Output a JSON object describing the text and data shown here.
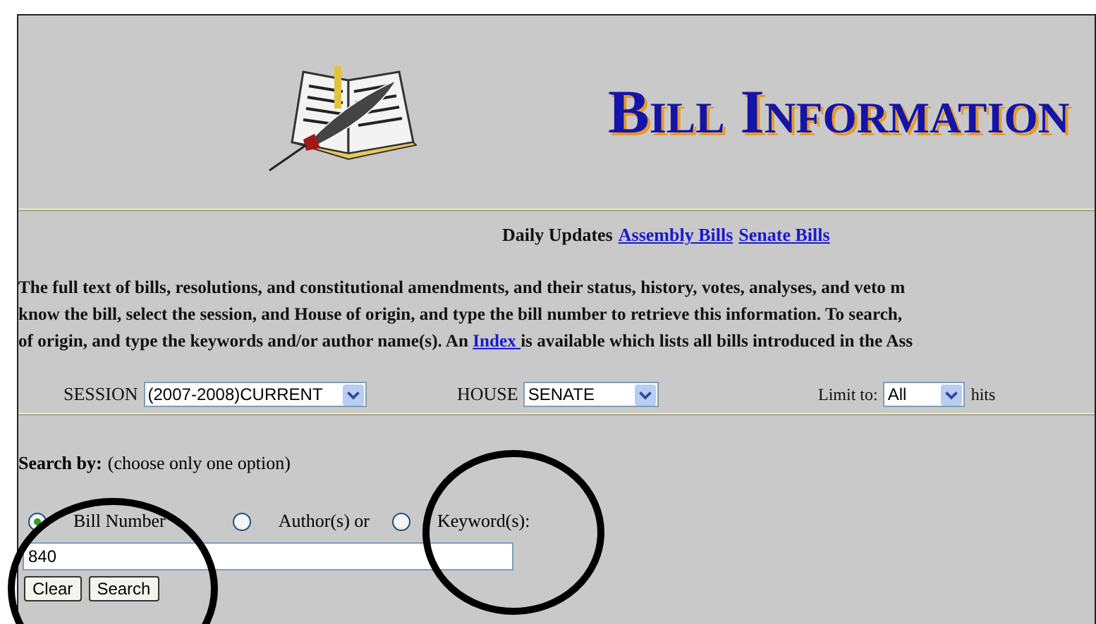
{
  "header": {
    "title": "Bill Information"
  },
  "daily_updates": {
    "label": "Daily Updates",
    "links": [
      "Assembly Bills",
      "Senate Bills"
    ]
  },
  "intro": {
    "line_1": "The full text of bills, resolutions, and constitutional amendments, and their status, history, votes, analyses, and veto m",
    "line_2": "know the bill, select the session, and House of origin, and type the bill number to retrieve this information. To search,",
    "line_3_before": "of origin, and type the keywords and/or author name(s). An ",
    "index_link": "Index ",
    "line_3_after": "is available which lists all bills introduced in the Ass"
  },
  "filters": [
    {
      "label": "SESSION",
      "value": "(2007-2008)CURRENT"
    },
    {
      "label": "HOUSE",
      "value": "SENATE"
    },
    {
      "label": "Limit to:",
      "value": "All",
      "suffix": "hits"
    }
  ],
  "search_by": {
    "label": "Search by:",
    "hint": "(choose only one option)"
  },
  "options": [
    {
      "label": "Bill Number",
      "selected": true
    },
    {
      "label": "Author(s) or",
      "selected": false
    },
    {
      "label": "Keyword(s):",
      "selected": false
    }
  ],
  "query": {
    "value": "840"
  },
  "buttons": [
    "Clear",
    "Search"
  ]
}
